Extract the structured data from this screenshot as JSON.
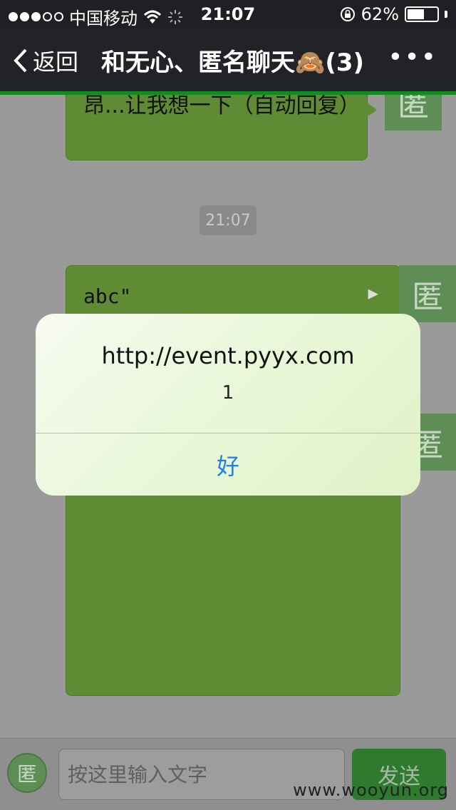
{
  "status_bar": {
    "carrier": "中国移动",
    "time": "21:07",
    "battery": "62%",
    "battery_level": 0.62
  },
  "nav": {
    "back_label": "返回",
    "title": "和无心、匿名聊天🙈(3)",
    "more": "•••"
  },
  "chat": {
    "messages": [
      {
        "text": "昂...让我想一下（自动回复）",
        "avatar": "匿"
      },
      {
        "text": "abc\"",
        "avatar": "匿"
      }
    ],
    "time_badge": "21:07",
    "extra_avatar": "匿"
  },
  "input_bar": {
    "avatar": "匿",
    "placeholder": "按这里输入文字",
    "send_label": "发送"
  },
  "watermark": "www.wooyun.org",
  "alert": {
    "title": "http://event.pyyx.com",
    "message": "1",
    "button": "好"
  },
  "colors": {
    "bubble": "#5f8b34",
    "alert_button": "#1e7ff2",
    "progress": "#0f8e1e"
  }
}
